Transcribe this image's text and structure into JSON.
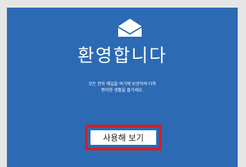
{
  "welcome": {
    "title": "환영합니다",
    "description_line1": "모든 전자 메일을 여기에 보관하여 더욱",
    "description_line2": "편리한 생활을 즐기세요.",
    "start_button_label": "사용해 보기"
  },
  "icons": {
    "envelope": "envelope-icon"
  },
  "colors": {
    "background": "#2c6ab4",
    "highlight": "#d32020",
    "text": "#ffffff"
  }
}
